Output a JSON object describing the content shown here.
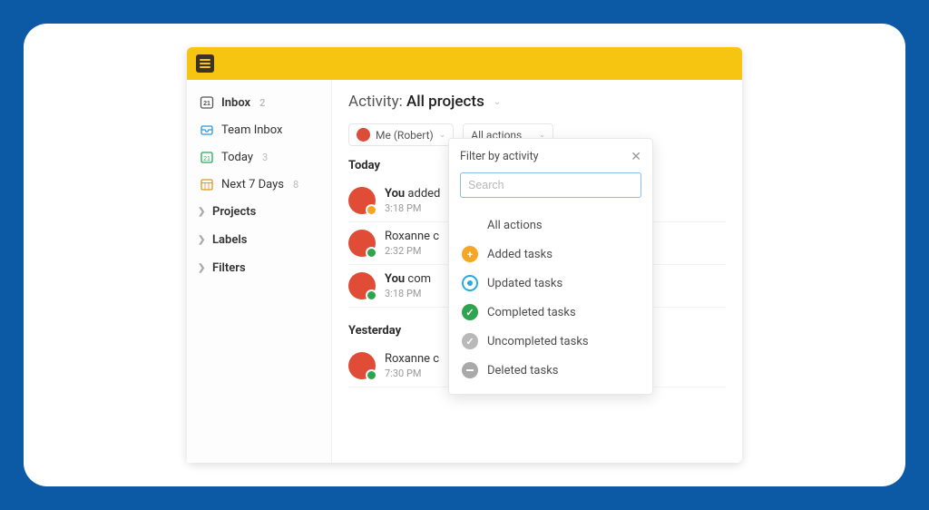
{
  "sidebar": {
    "inbox": {
      "label": "Inbox",
      "count": "2"
    },
    "teamInbox": {
      "label": "Team Inbox"
    },
    "today": {
      "label": "Today",
      "count": "3"
    },
    "next7": {
      "label": "Next 7 Days",
      "count": "8"
    },
    "projects": {
      "label": "Projects"
    },
    "labels": {
      "label": "Labels"
    },
    "filters": {
      "label": "Filters"
    }
  },
  "header": {
    "titlePrefix": "Activity: ",
    "titleMain": "All projects"
  },
  "filterPills": {
    "user": "Me (Robert)",
    "actions": "All actions"
  },
  "sections": {
    "today": "Today",
    "yesterday": "Yesterday"
  },
  "activity": {
    "today": [
      {
        "userBold": "You",
        "rest": " added",
        "time": "3:18 PM",
        "badge": "orange"
      },
      {
        "userBold": "",
        "rest": "Roxanne c",
        "time": "2:32 PM",
        "badge": "green"
      },
      {
        "userBold": "You",
        "rest": " com",
        "time": "3:18 PM",
        "badge": "green"
      }
    ],
    "yesterday": [
      {
        "userBold": "",
        "rest": "Roxanne c",
        "time": "7:30 PM",
        "badge": "green"
      }
    ]
  },
  "popover": {
    "title": "Filter by activity",
    "placeholder": "Search",
    "options": [
      {
        "label": "All actions",
        "kind": "none"
      },
      {
        "label": "Added tasks",
        "kind": "add"
      },
      {
        "label": "Updated tasks",
        "kind": "upd"
      },
      {
        "label": "Completed tasks",
        "kind": "comp"
      },
      {
        "label": "Uncompleted tasks",
        "kind": "uncomp"
      },
      {
        "label": "Deleted tasks",
        "kind": "del"
      }
    ]
  }
}
